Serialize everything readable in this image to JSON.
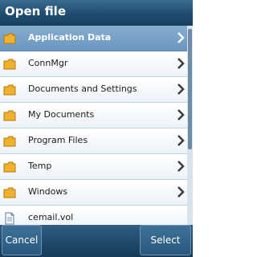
{
  "title": "Open file",
  "items": [
    {
      "label": "Application Data",
      "type": "folder",
      "selected": true
    },
    {
      "label": "ConnMgr",
      "type": "folder",
      "selected": false
    },
    {
      "label": "Documents and Settings",
      "type": "folder",
      "selected": false
    },
    {
      "label": "My Documents",
      "type": "folder",
      "selected": false
    },
    {
      "label": "Program Files",
      "type": "folder",
      "selected": false
    },
    {
      "label": "Temp",
      "type": "folder",
      "selected": false
    },
    {
      "label": "Windows",
      "type": "folder",
      "selected": false
    },
    {
      "label": "cemail.vol",
      "type": "file",
      "selected": false
    }
  ],
  "softkeys": {
    "left": "Cancel",
    "right": "Select"
  },
  "icons": {
    "folder": "folder-icon",
    "file": "file-icon",
    "chevron": "chevron-right-icon"
  },
  "colors": {
    "accent": "#1f4d70",
    "selection": "#7aa3c8",
    "folder": "#f2b02b"
  }
}
